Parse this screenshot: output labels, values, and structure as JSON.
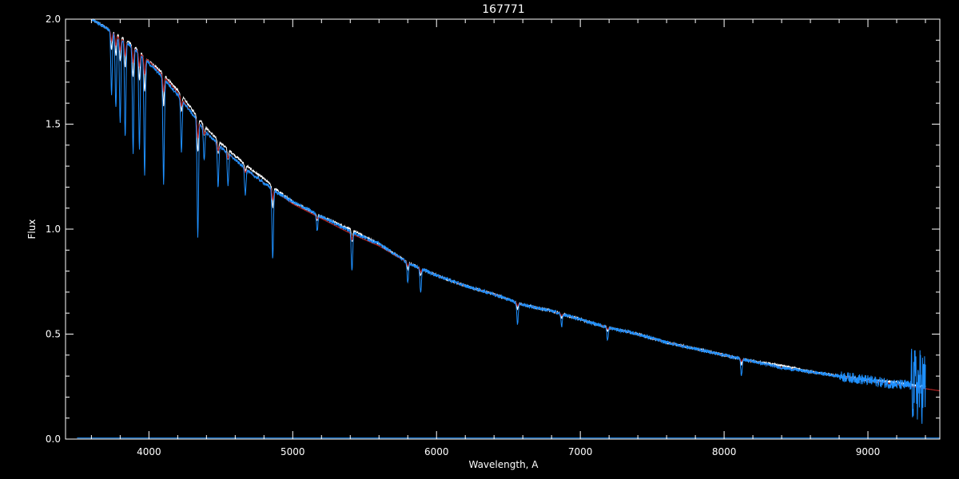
{
  "chart_data": {
    "type": "line",
    "title": "167771",
    "xlabel": "Wavelength, A",
    "ylabel": "Flux",
    "xlim": [
      3420,
      9500
    ],
    "ylim": [
      0,
      2.0
    ],
    "x_ticks": [
      4000,
      5000,
      6000,
      7000,
      8000,
      9000
    ],
    "x_tick_labels": [
      "4000",
      "5000",
      "6000",
      "7000",
      "8000",
      "9000"
    ],
    "y_ticks": [
      0.0,
      0.5,
      1.0,
      1.5,
      2.0
    ],
    "y_tick_labels": [
      "0.0",
      "0.5",
      "1.0",
      "1.5",
      "2.0"
    ],
    "grid": false,
    "background": "#000000",
    "axis_color": "#ffffff",
    "series": [
      {
        "color": "#ffffff",
        "style": "observed-white",
        "x": [
          3600,
          3700,
          3800,
          3900,
          4000,
          4100,
          4200,
          4300,
          4400,
          4500,
          4600,
          4700,
          4800,
          4900,
          5000,
          5200,
          5400,
          5600,
          5800,
          6000,
          6200,
          6400,
          6600,
          6800,
          7000,
          7200,
          7400,
          7600,
          7800,
          8000,
          8200,
          8400,
          8600,
          8800,
          9000,
          9200,
          9400
        ],
        "y": [
          2.0,
          1.96,
          1.92,
          1.87,
          1.8,
          1.74,
          1.66,
          1.57,
          1.48,
          1.41,
          1.35,
          1.29,
          1.24,
          1.18,
          1.13,
          1.06,
          1.0,
          0.93,
          0.84,
          0.78,
          0.73,
          0.69,
          0.64,
          0.61,
          0.57,
          0.53,
          0.5,
          0.46,
          0.43,
          0.4,
          0.37,
          0.35,
          0.32,
          0.3,
          0.28,
          0.27,
          0.25
        ]
      },
      {
        "color": "#b22222",
        "style": "model",
        "x": [
          3600,
          3700,
          3800,
          3900,
          4000,
          4100,
          4200,
          4300,
          4400,
          4500,
          4600,
          4700,
          4800,
          4900,
          5000,
          5200,
          5400,
          5600,
          5800,
          6000,
          6200,
          6400,
          6600,
          6800,
          7000,
          7200,
          7400,
          7600,
          7800,
          8000,
          8200,
          8400,
          8600,
          8800,
          9000,
          9200,
          9400,
          9500
        ],
        "y": [
          2.0,
          1.96,
          1.91,
          1.86,
          1.8,
          1.73,
          1.65,
          1.55,
          1.46,
          1.39,
          1.33,
          1.27,
          1.22,
          1.17,
          1.12,
          1.05,
          0.98,
          0.92,
          0.84,
          0.78,
          0.73,
          0.69,
          0.64,
          0.61,
          0.57,
          0.53,
          0.5,
          0.46,
          0.43,
          0.4,
          0.37,
          0.34,
          0.32,
          0.3,
          0.28,
          0.26,
          0.24,
          0.23
        ]
      },
      {
        "color": "#1e90ff",
        "style": "observed-blue",
        "x": [
          3600,
          3700,
          3800,
          3900,
          4000,
          4100,
          4200,
          4300,
          4400,
          4500,
          4600,
          4700,
          4800,
          4900,
          5000,
          5200,
          5400,
          5600,
          5800,
          6000,
          6200,
          6400,
          6600,
          6800,
          7000,
          7200,
          7400,
          7600,
          7800,
          8000,
          8200,
          8400,
          8600,
          8800,
          9000,
          9200,
          9400
        ],
        "y": [
          2.0,
          1.96,
          1.91,
          1.86,
          1.79,
          1.72,
          1.64,
          1.55,
          1.46,
          1.39,
          1.33,
          1.27,
          1.22,
          1.17,
          1.13,
          1.06,
          0.99,
          0.93,
          0.84,
          0.78,
          0.73,
          0.69,
          0.64,
          0.61,
          0.57,
          0.53,
          0.5,
          0.46,
          0.43,
          0.4,
          0.37,
          0.34,
          0.32,
          0.3,
          0.28,
          0.26,
          0.25
        ]
      }
    ],
    "absorption_lines": [
      {
        "x": 3740,
        "depth": 0.3
      },
      {
        "x": 3770,
        "depth": 0.35
      },
      {
        "x": 3800,
        "depth": 0.4
      },
      {
        "x": 3835,
        "depth": 0.45
      },
      {
        "x": 3890,
        "depth": 0.5
      },
      {
        "x": 3934,
        "depth": 0.45
      },
      {
        "x": 3970,
        "depth": 0.55
      },
      {
        "x": 4102,
        "depth": 0.5
      },
      {
        "x": 4226,
        "depth": 0.25
      },
      {
        "x": 4340,
        "depth": 0.55
      },
      {
        "x": 4384,
        "depth": 0.15
      },
      {
        "x": 4481,
        "depth": 0.2
      },
      {
        "x": 4550,
        "depth": 0.15
      },
      {
        "x": 4670,
        "depth": 0.12
      },
      {
        "x": 4861,
        "depth": 0.33
      },
      {
        "x": 5170,
        "depth": 0.08
      },
      {
        "x": 5412,
        "depth": 0.18
      },
      {
        "x": 5800,
        "depth": 0.1
      },
      {
        "x": 5890,
        "depth": 0.12
      },
      {
        "x": 6563,
        "depth": 0.1
      },
      {
        "x": 6870,
        "depth": 0.06
      },
      {
        "x": 7190,
        "depth": 0.06
      },
      {
        "x": 8120,
        "depth": 0.08
      }
    ]
  }
}
